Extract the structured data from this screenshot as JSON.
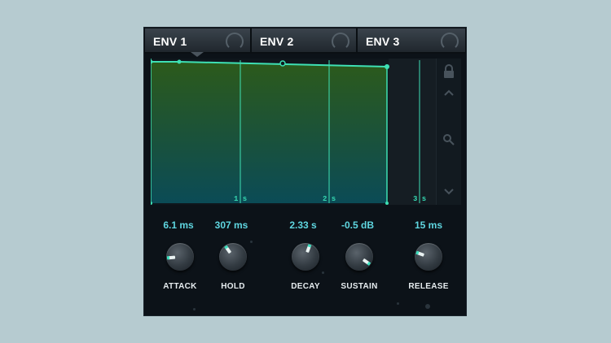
{
  "tabs": [
    {
      "label": "ENV 1",
      "icon": "power-arc-icon"
    },
    {
      "label": "ENV 2",
      "icon": "power-arc-icon"
    },
    {
      "label": "ENV 3",
      "icon": "power-arc-icon"
    }
  ],
  "graph": {
    "time_labels": [
      "1 s",
      "2 s",
      "3 s"
    ],
    "line_color": "#3ee0b4",
    "fill_top": "#2a5a1c",
    "fill_bottom": "#0c4a55"
  },
  "sidebar": {
    "icons": [
      "lock-icon",
      "chevron-up-icon",
      "zoom-icon",
      "chevron-down-icon"
    ]
  },
  "params": [
    {
      "name": "ATTACK",
      "value": "6.1 ms"
    },
    {
      "name": "HOLD",
      "value": "307 ms"
    },
    {
      "name": "DECAY",
      "value": "2.33 s"
    },
    {
      "name": "SUSTAIN",
      "value": "-0.5 dB"
    },
    {
      "name": "RELEASE",
      "value": "15 ms"
    }
  ],
  "colors": {
    "accent": "#3ee0b4",
    "value_text": "#5fd6e0"
  }
}
